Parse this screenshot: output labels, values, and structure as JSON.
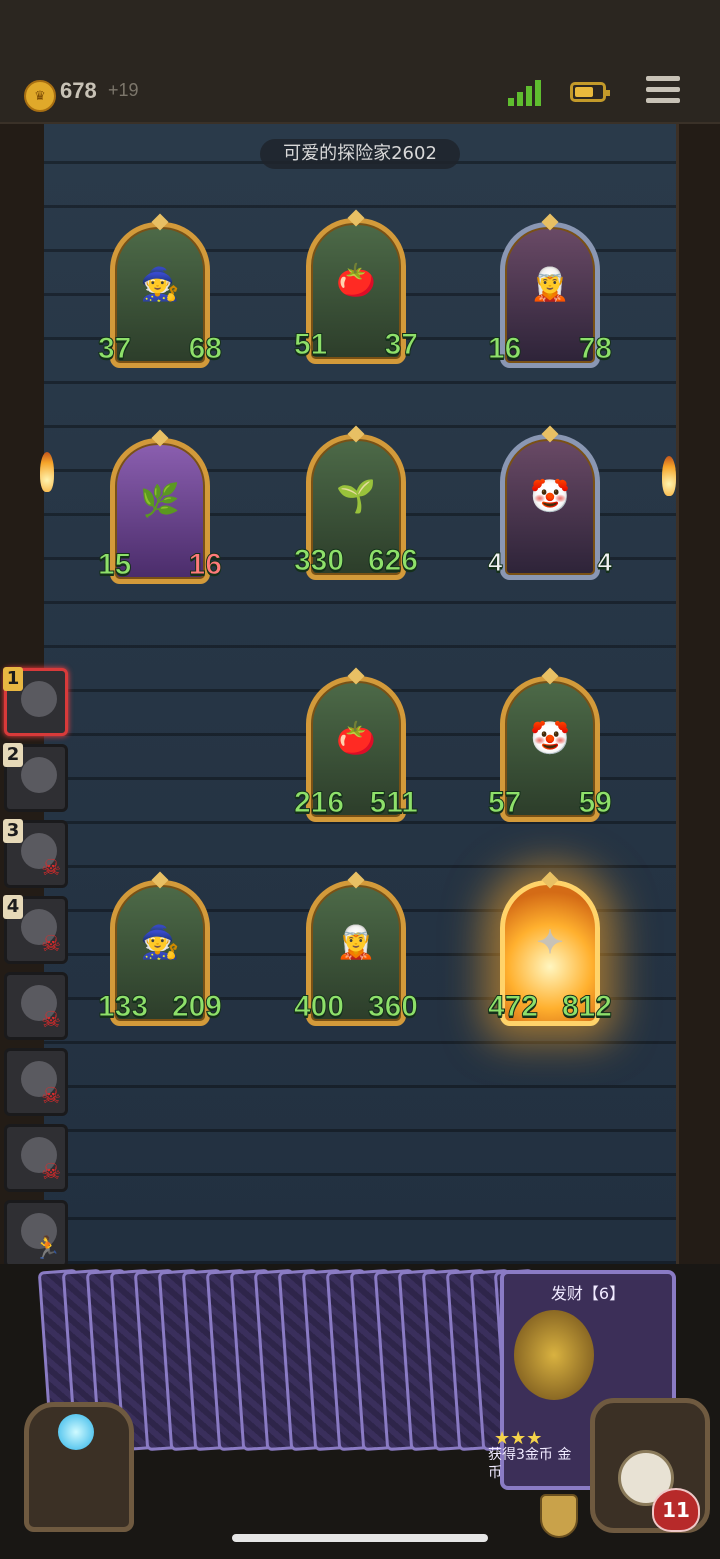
{
  "status": {
    "gold": "678",
    "gold_delta": "+19",
    "icons": [
      "coin-icon",
      "signal-icon",
      "battery-icon",
      "menu-icon"
    ]
  },
  "opponent": {
    "name": "可爱的探险家2602"
  },
  "enemy_board": [
    {
      "name": "witch-card",
      "atk": "37",
      "hp": "68"
    },
    {
      "name": "tomato-card",
      "atk": "51",
      "hp": "37"
    },
    {
      "name": "elf-card",
      "atk": "16",
      "hp": "78"
    },
    {
      "name": "vine-card",
      "atk": "15",
      "hp": "16"
    },
    {
      "name": "leaf-girl-card",
      "atk": "330",
      "hp": "626"
    },
    {
      "name": "clown-card",
      "atk": "4",
      "hp": "4"
    }
  ],
  "player_board": [
    {
      "name": "tomato-card",
      "atk": "216",
      "hp": "511"
    },
    {
      "name": "clown-card",
      "atk": "57",
      "hp": "59"
    },
    {
      "name": "witch-card",
      "atk": "133",
      "hp": "209"
    },
    {
      "name": "elf-card",
      "atk": "400",
      "hp": "360"
    },
    {
      "name": "glowing-card",
      "atk": "472",
      "hp": "812"
    }
  ],
  "party": [
    "1",
    "2",
    "3",
    "4"
  ],
  "hand_card": {
    "title": "发财【6】",
    "text": "获得3金币 金币"
  },
  "hero": {
    "hp": "11"
  }
}
